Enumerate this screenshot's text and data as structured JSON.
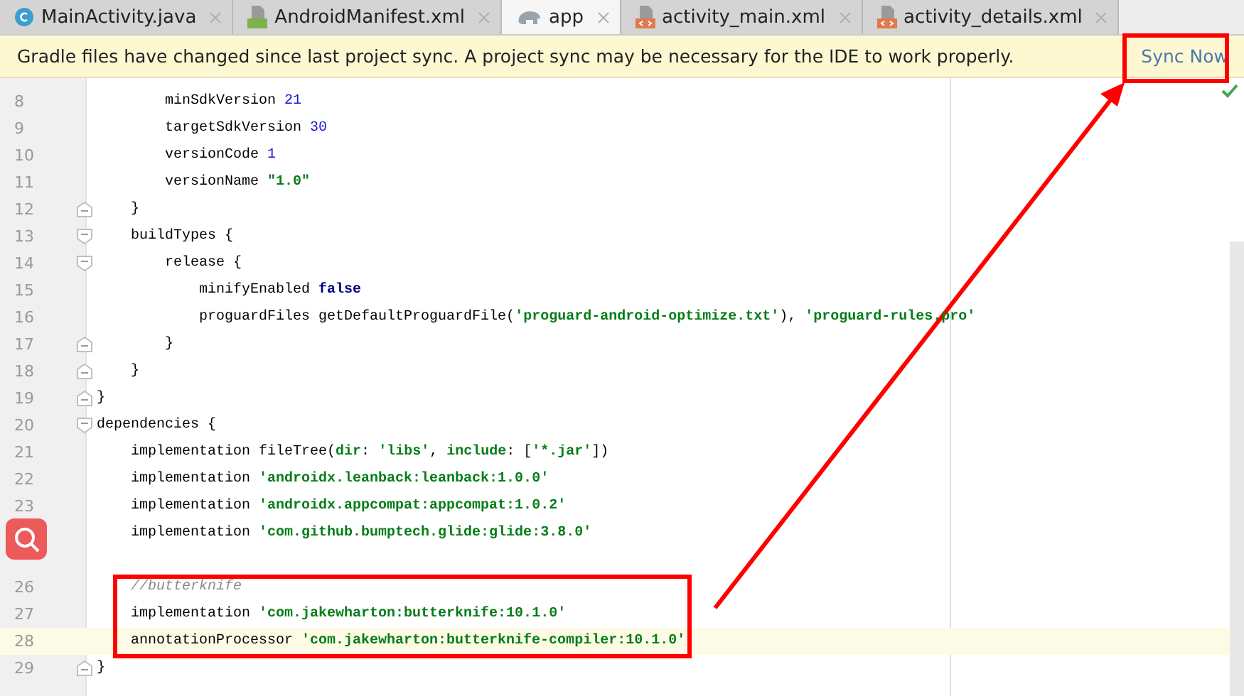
{
  "tabs": [
    {
      "label": "MainActivity.java",
      "kind": "java",
      "selected": false
    },
    {
      "label": "AndroidManifest.xml",
      "kind": "manifest",
      "selected": false
    },
    {
      "label": "app",
      "kind": "gradle",
      "selected": true
    },
    {
      "label": "activity_main.xml",
      "kind": "layout",
      "selected": false
    },
    {
      "label": "activity_details.xml",
      "kind": "layout",
      "selected": false
    }
  ],
  "banner": {
    "message": "Gradle files have changed since last project sync. A project sync may be necessary for the IDE to work properly.",
    "action": "Sync Now"
  },
  "lines": [
    {
      "number": "8",
      "tokens": [
        {
          "kind": "plain",
          "text": "        minSdkVersion "
        },
        {
          "kind": "num",
          "text": "21"
        }
      ]
    },
    {
      "number": "9",
      "tokens": [
        {
          "kind": "plain",
          "text": "        targetSdkVersion "
        },
        {
          "kind": "num",
          "text": "30"
        }
      ]
    },
    {
      "number": "10",
      "tokens": [
        {
          "kind": "plain",
          "text": "        versionCode "
        },
        {
          "kind": "num",
          "text": "1"
        }
      ]
    },
    {
      "number": "11",
      "tokens": [
        {
          "kind": "plain",
          "text": "        versionName "
        },
        {
          "kind": "str",
          "text": "\"1.0\""
        }
      ]
    },
    {
      "number": "12",
      "fold_end": true,
      "tokens": [
        {
          "kind": "plain",
          "text": "    }"
        }
      ]
    },
    {
      "number": "13",
      "fold_start": true,
      "tokens": [
        {
          "kind": "plain",
          "text": "    buildTypes {"
        }
      ]
    },
    {
      "number": "14",
      "fold_start": true,
      "tokens": [
        {
          "kind": "plain",
          "text": "        release {"
        }
      ]
    },
    {
      "number": "15",
      "tokens": [
        {
          "kind": "plain",
          "text": "            minifyEnabled "
        },
        {
          "kind": "kw",
          "text": "false"
        }
      ]
    },
    {
      "number": "16",
      "tokens": [
        {
          "kind": "plain",
          "text": "            proguardFiles getDefaultProguardFile("
        },
        {
          "kind": "str",
          "text": "'proguard-android-optimize.txt'"
        },
        {
          "kind": "plain",
          "text": "), "
        },
        {
          "kind": "str",
          "text": "'proguard-rules.pro'"
        }
      ]
    },
    {
      "number": "17",
      "fold_end": true,
      "tokens": [
        {
          "kind": "plain",
          "text": "        }"
        }
      ]
    },
    {
      "number": "18",
      "fold_end": true,
      "tokens": [
        {
          "kind": "plain",
          "text": "    }"
        }
      ]
    },
    {
      "number": "19",
      "fold_end": true,
      "tokens": [
        {
          "kind": "plain",
          "text": "}"
        }
      ]
    },
    {
      "number": "20",
      "fold_start": true,
      "tokens": [
        {
          "kind": "plain",
          "text": "dependencies {"
        }
      ]
    },
    {
      "number": "21",
      "tokens": [
        {
          "kind": "plain",
          "text": "    implementation fileTree("
        },
        {
          "kind": "str",
          "text": "dir"
        },
        {
          "kind": "plain",
          "text": ": "
        },
        {
          "kind": "str",
          "text": "'libs'"
        },
        {
          "kind": "plain",
          "text": ", "
        },
        {
          "kind": "str",
          "text": "include"
        },
        {
          "kind": "plain",
          "text": ": ["
        },
        {
          "kind": "str",
          "text": "'*.jar'"
        },
        {
          "kind": "plain",
          "text": "])"
        }
      ]
    },
    {
      "number": "22",
      "tokens": [
        {
          "kind": "plain",
          "text": "    implementation "
        },
        {
          "kind": "str",
          "text": "'androidx.leanback:leanback:1.0.0'"
        }
      ]
    },
    {
      "number": "23",
      "tokens": [
        {
          "kind": "plain",
          "text": "    implementation "
        },
        {
          "kind": "str",
          "text": "'androidx.appcompat:appcompat:1.0.2'"
        }
      ]
    },
    {
      "tokens": [
        {
          "kind": "plain",
          "text": "    implementation "
        },
        {
          "kind": "str",
          "text": "'com.github.bumptech.glide:glide:3.8.0'"
        }
      ]
    },
    {
      "number": "26",
      "blank_line_before": true,
      "tokens": [
        {
          "kind": "comment",
          "text": "    //butterknife"
        }
      ]
    },
    {
      "number": "27",
      "tokens": [
        {
          "kind": "plain",
          "text": "    implementation "
        },
        {
          "kind": "str",
          "text": "'com.jakewharton:butterknife:10.1.0'"
        }
      ]
    },
    {
      "number": "28",
      "current": true,
      "tokens": [
        {
          "kind": "plain",
          "text": "    annotationProcessor "
        },
        {
          "kind": "str",
          "text": "'com.jakewharton:butterknife-compiler:10.1.0'"
        }
      ]
    },
    {
      "number": "29",
      "fold_end": true,
      "tokens": [
        {
          "kind": "plain",
          "text": "}"
        }
      ]
    }
  ]
}
